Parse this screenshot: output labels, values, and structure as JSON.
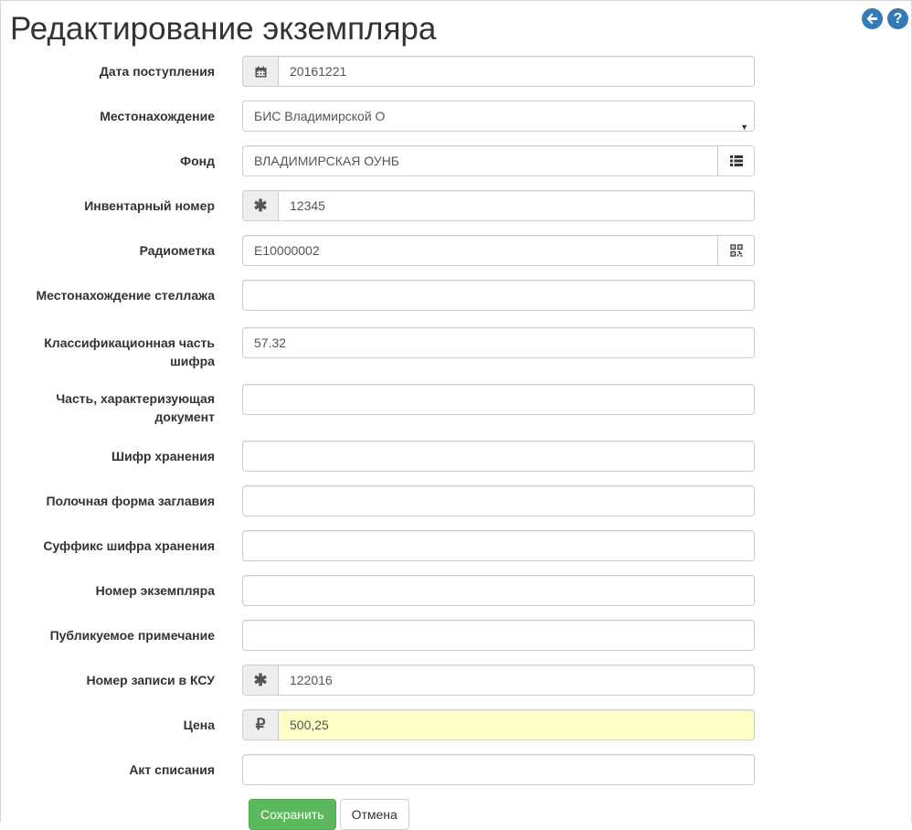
{
  "page": {
    "title": "Редактирование экземпляра"
  },
  "icons": {
    "back": "arrow-left-circle-icon",
    "help": "question-circle-icon",
    "accent": "#337ab7"
  },
  "fields": {
    "date": {
      "label": "Дата поступления",
      "value": "20161221",
      "icon": "calendar-icon"
    },
    "location": {
      "label": "Местонахождение",
      "value": "БИС Владимирской О"
    },
    "fund": {
      "label": "Фонд",
      "value": "ВЛАДИМИРСКАЯ ОУНБ",
      "icon": "list-icon"
    },
    "inventory": {
      "label": "Инвентарный номер",
      "value": "12345",
      "icon": "asterisk-icon"
    },
    "rfid": {
      "label": "Радиометка",
      "value": "E10000002",
      "icon": "qrcode-icon"
    },
    "shelf": {
      "label": "Местонахождение стеллажа",
      "value": ""
    },
    "classification": {
      "label": "Классификационная часть шифра",
      "value": "57.32"
    },
    "doc_part": {
      "label": "Часть, характеризующая документ",
      "value": ""
    },
    "storage_code": {
      "label": "Шифр хранения",
      "value": ""
    },
    "shelf_title": {
      "label": "Полочная форма заглавия",
      "value": ""
    },
    "storage_suffix": {
      "label": "Суффикс шифра хранения",
      "value": ""
    },
    "copy_number": {
      "label": "Номер экземпляра",
      "value": ""
    },
    "public_note": {
      "label": "Публикуемое примечание",
      "value": ""
    },
    "ksu_record": {
      "label": "Номер записи в КСУ",
      "value": "122016",
      "icon": "asterisk-icon"
    },
    "price": {
      "label": "Цена",
      "value": "500,25",
      "icon": "ruble-icon",
      "currency_symbol": "₽",
      "highlight_color": "#ffffc8"
    },
    "writeoff": {
      "label": "Акт списания",
      "value": ""
    }
  },
  "actions": {
    "save_label": "Сохранить",
    "cancel_label": "Отмена",
    "save_color": "#5cb85c"
  }
}
